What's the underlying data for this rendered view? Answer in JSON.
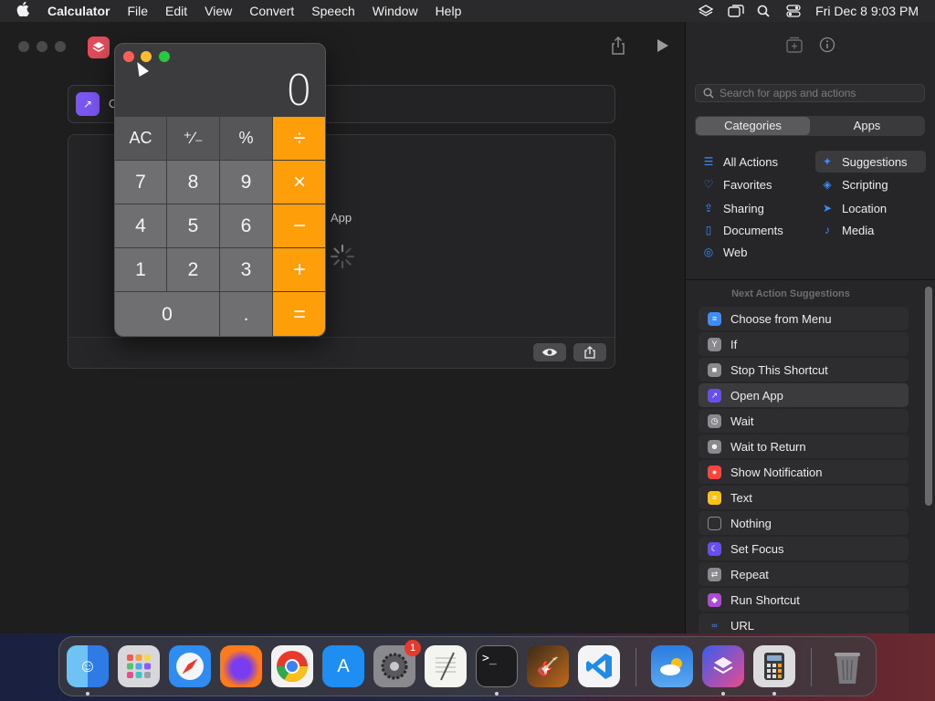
{
  "menubar": {
    "app_name": "Calculator",
    "menus": [
      "File",
      "Edit",
      "View",
      "Convert",
      "Speech",
      "Window",
      "Help"
    ],
    "datetime": "Fri Dec 8  9:03 PM"
  },
  "shortcut_editor": {
    "title_field_text": "O",
    "card_label": "App"
  },
  "panel": {
    "search_placeholder": "Search for apps and actions",
    "segments": [
      "Categories",
      "Apps"
    ],
    "categories_left": [
      {
        "label": "All Actions",
        "icon": "list-icon"
      },
      {
        "label": "Favorites",
        "icon": "heart-icon"
      },
      {
        "label": "Sharing",
        "icon": "share-icon"
      },
      {
        "label": "Documents",
        "icon": "document-icon"
      },
      {
        "label": "Web",
        "icon": "compass-icon"
      }
    ],
    "categories_right": [
      {
        "label": "Suggestions",
        "icon": "sparkle-icon"
      },
      {
        "label": "Scripting",
        "icon": "scripting-icon"
      },
      {
        "label": "Location",
        "icon": "location-icon"
      },
      {
        "label": "Media",
        "icon": "music-note-icon"
      }
    ],
    "suggestions_heading": "Next Action Suggestions",
    "suggestions": [
      {
        "label": "Choose from Menu",
        "color": "#3b8cff"
      },
      {
        "label": "If",
        "color": "#8a8a8e"
      },
      {
        "label": "Stop This Shortcut",
        "color": "#8a8a8e"
      },
      {
        "label": "Open App",
        "color": "#6a4df0"
      },
      {
        "label": "Wait",
        "color": "#8a8a8e"
      },
      {
        "label": "Wait to Return",
        "color": "#8a8a8e"
      },
      {
        "label": "Show Notification",
        "color": "#ff453a"
      },
      {
        "label": "Text",
        "color": "#ffc40a"
      },
      {
        "label": "Nothing",
        "color": "#3a3a3c"
      },
      {
        "label": "Set Focus",
        "color": "#6a4df0"
      },
      {
        "label": "Repeat",
        "color": "#8a8a8e"
      },
      {
        "label": "Run Shortcut",
        "color": "#b048d8"
      },
      {
        "label": "URL",
        "color": "#3a3a3c"
      }
    ]
  },
  "calculator": {
    "display": "0",
    "keys": [
      [
        "AC",
        "⁺∕₋",
        "%",
        "÷"
      ],
      [
        "7",
        "8",
        "9",
        "×"
      ],
      [
        "4",
        "5",
        "6",
        "−"
      ],
      [
        "1",
        "2",
        "3",
        "+"
      ],
      [
        "0",
        ".",
        "="
      ]
    ]
  },
  "dock": {
    "items": [
      "finder",
      "launchpad",
      "safari",
      "firefox",
      "chrome",
      "app-store",
      "system-settings",
      "textedit",
      "terminal",
      "garageband",
      "vscode",
      "weather",
      "shortcuts",
      "calculator",
      "trash"
    ],
    "system_settings_badge": "1"
  },
  "colors": {
    "operator_key": "#fe9f0a",
    "number_key": "#6f6f71",
    "function_key": "#565658"
  }
}
